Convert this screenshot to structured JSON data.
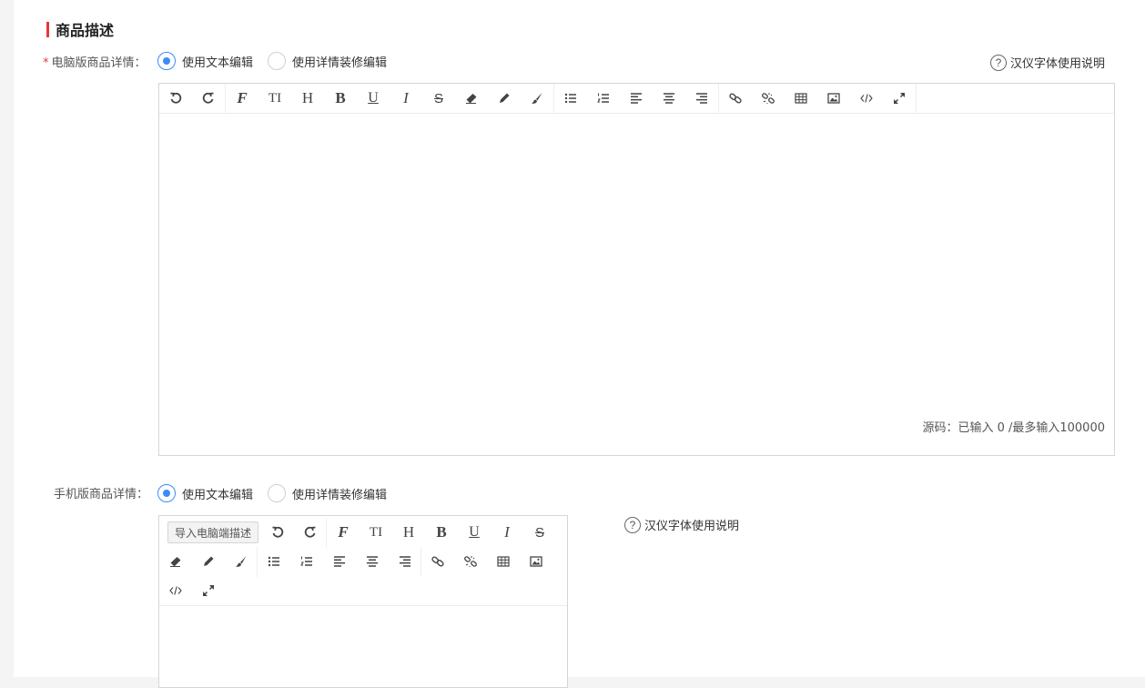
{
  "section": {
    "title": "商品描述"
  },
  "pc": {
    "label": "电脑版商品详情：",
    "required_mark": "*",
    "radio_text": "使用文本编辑",
    "radio_detail": "使用详情装修编辑",
    "help": "汉仪字体使用说明",
    "counter": "源码：已输入 0 /最多输入100000"
  },
  "mobile": {
    "label": "手机版商品详情：",
    "radio_text": "使用文本编辑",
    "radio_detail": "使用详情装修编辑",
    "help": "汉仪字体使用说明",
    "import_button": "导入电脑端描述"
  },
  "toolbar_glyphs": {
    "font": "F",
    "size": "TI",
    "heading": "H",
    "bold": "B",
    "underline": "U",
    "italic": "I",
    "strike": "S"
  },
  "help_icon": "?",
  "colors": {
    "accent": "#3b8cf7",
    "section_bar": "#e4393c",
    "required": "#e4393c"
  }
}
